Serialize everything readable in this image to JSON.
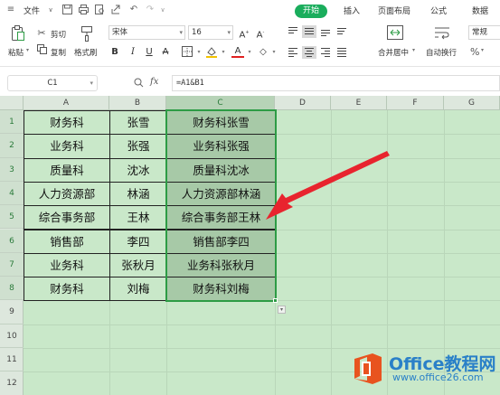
{
  "menubar": {
    "file_label": "文件",
    "tabs": [
      "开始",
      "插入",
      "页面布局",
      "公式",
      "数据"
    ]
  },
  "toolbar": {
    "paste_label": "粘贴",
    "cut_label": "剪切",
    "copy_label": "复制",
    "format_painter_label": "格式刷",
    "font_name": "宋体",
    "font_size": "16",
    "merge_center_label": "合并居中",
    "wrap_text_label": "自动换行",
    "number_format": "常规",
    "percent_symbol": "%"
  },
  "formula_bar": {
    "name_box": "C1",
    "fx_label": "fx",
    "formula": "=A1&B1"
  },
  "grid": {
    "columns": [
      "A",
      "B",
      "C",
      "D",
      "E",
      "F",
      "G"
    ],
    "row_numbers": [
      "1",
      "2",
      "3",
      "4",
      "5",
      "6",
      "7",
      "8",
      "9",
      "10",
      "11",
      "12"
    ],
    "rows": [
      [
        "财务科",
        "张雪",
        "财务科张雪"
      ],
      [
        "业务科",
        "张强",
        "业务科张强"
      ],
      [
        "质量科",
        "沈冰",
        "质量科沈冰"
      ],
      [
        "人力资源部",
        "林涵",
        "人力资源部林涵"
      ],
      [
        "综合事务部",
        "王林",
        "综合事务部王林"
      ],
      [
        "销售部",
        "李四",
        "销售部李四"
      ],
      [
        "业务科",
        "张秋月",
        "业务科张秋月"
      ],
      [
        "财务科",
        "刘梅",
        "财务科刘梅"
      ]
    ]
  },
  "watermark": {
    "name": "Office教程网",
    "url": "www.office26.com"
  },
  "colors": {
    "accent": "#1aad5c",
    "sheet_bg": "#c9e8c9",
    "selection": "#2d9c45",
    "arrow": "#e8242e",
    "logo": "#e8531f"
  }
}
